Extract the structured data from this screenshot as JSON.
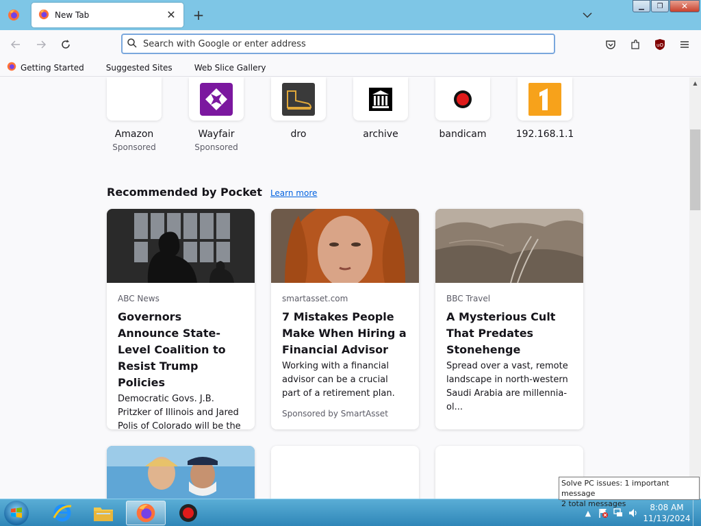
{
  "browser": {
    "tab": {
      "title": "New Tab"
    },
    "urlbar": {
      "placeholder": "Search with Google or enter address"
    },
    "bookmarks": [
      {
        "label": "Getting Started"
      },
      {
        "label": "Suggested Sites"
      },
      {
        "label": "Web Slice Gallery"
      }
    ]
  },
  "top_sites": [
    {
      "name": "Amazon",
      "sub": "Sponsored",
      "icon": "amazon-icon"
    },
    {
      "name": "Wayfair",
      "sub": "Sponsored",
      "icon": "wayfair-icon"
    },
    {
      "name": "dro",
      "sub": "",
      "icon": "boot-icon"
    },
    {
      "name": "archive",
      "sub": "",
      "icon": "archive-icon"
    },
    {
      "name": "bandicam",
      "sub": "",
      "icon": "bandicam-icon"
    },
    {
      "name": "192.168.1.1",
      "sub": "",
      "icon": "router-icon"
    }
  ],
  "pocket": {
    "title": "Recommended by Pocket",
    "learn_more": "Learn more",
    "cards": [
      {
        "source": "ABC News",
        "title": "Governors Announce State-Level Coalition to Resist Trump Policies",
        "excerpt": "Democratic Govs. J.B. Pritzker of Illinois and Jared Polis of Colorado will be the co-chai...",
        "sponsor": ""
      },
      {
        "source": "smartasset.com",
        "title": "7 Mistakes People Make When Hiring a Financial Advisor",
        "excerpt": "Working with a financial advisor can be a crucial part of a retirement plan.",
        "sponsor": "Sponsored by SmartAsset"
      },
      {
        "source": "BBC Travel",
        "title": "A Mysterious Cult That Predates Stonehenge",
        "excerpt": "Spread over a vast, remote landscape in north-western Saudi Arabia are millennia-ol...",
        "sponsor": ""
      }
    ]
  },
  "tooltip": {
    "line1": "Solve PC issues: 1 important message",
    "line2": "2 total messages"
  },
  "taskbar": {
    "time": "8:08 AM",
    "date": "11/13/2024"
  },
  "colors": {
    "titlebar": "#7ec6e6",
    "accent_link": "#0061e0",
    "wayfair": "#7b189f",
    "router_orange": "#f7a21b"
  }
}
